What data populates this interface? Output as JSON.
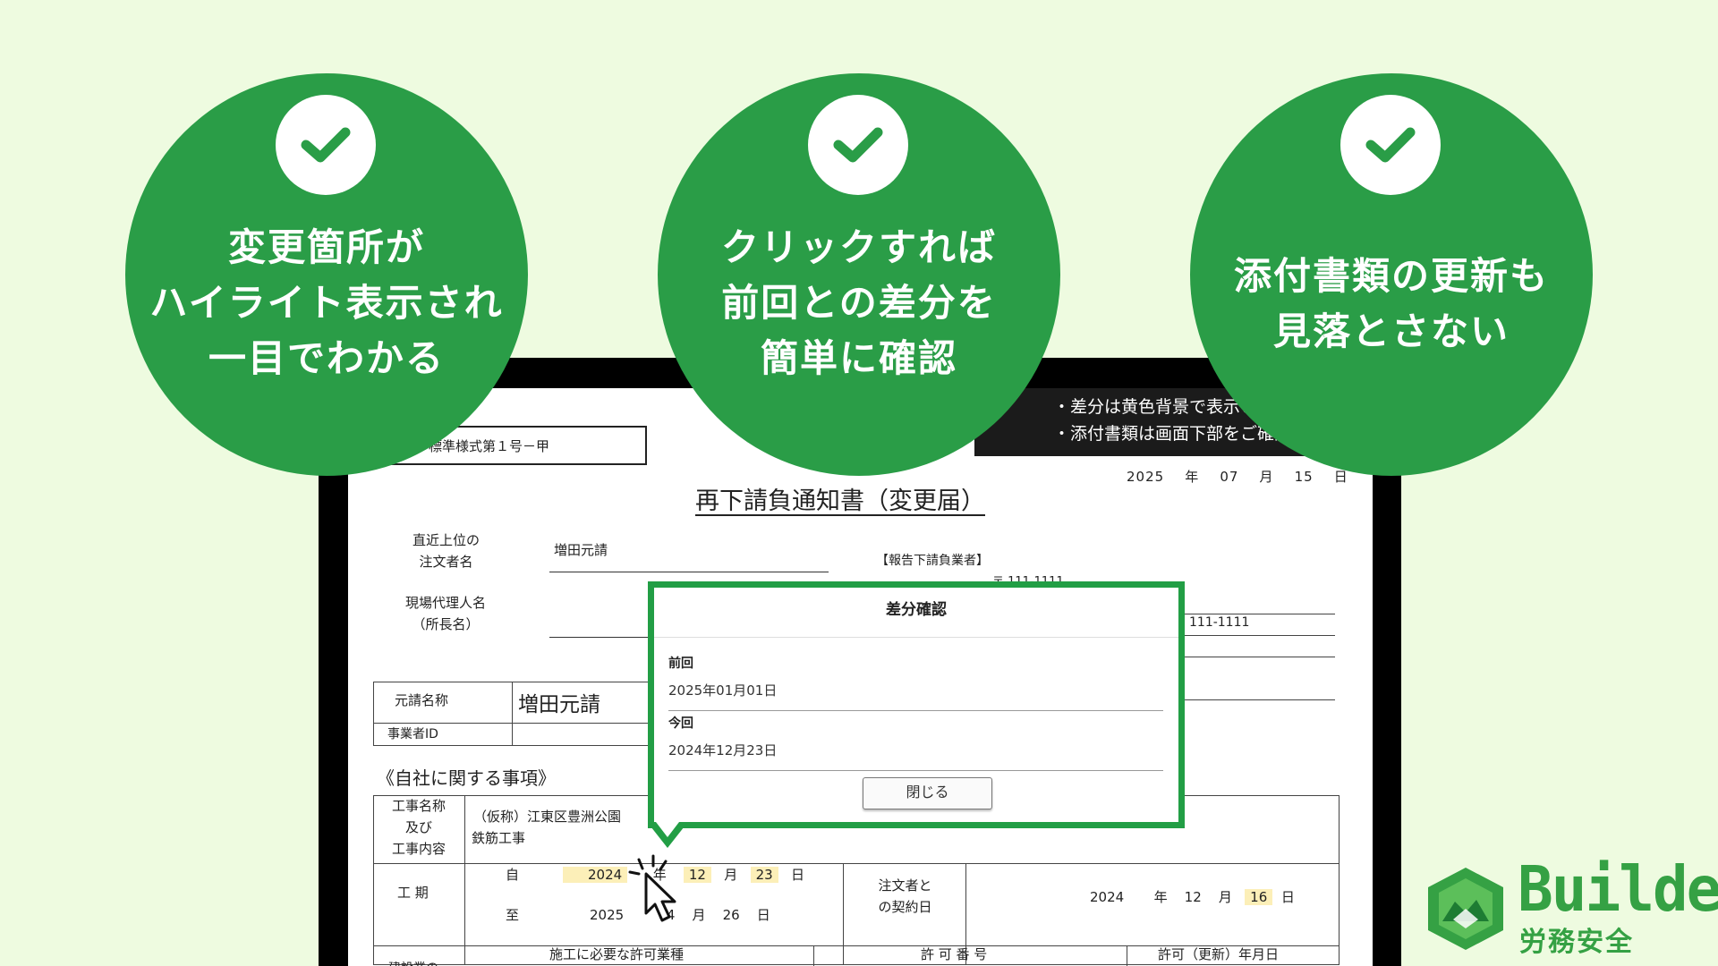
{
  "features": [
    {
      "lines": [
        "変更箇所が",
        "ハイライト表示され",
        "一目でわかる"
      ]
    },
    {
      "lines": [
        "クリックすれば",
        "前回との差分を",
        "簡単に確認"
      ]
    },
    {
      "lines": [
        "添付書類の更新も",
        "見落とさない"
      ]
    }
  ],
  "document": {
    "form_number": "標準様式第１号－甲",
    "notice_lines": [
      "・差分は黄色背景で表示され",
      "・添付書類は画面下部をご確認く"
    ],
    "date": {
      "year": "2025",
      "year_unit": "年",
      "month": "07",
      "month_unit": "月",
      "day": "15",
      "day_unit": "日"
    },
    "title": "再下請負通知書（変更届）",
    "orderer_label": [
      "直近上位の",
      "注文者名"
    ],
    "orderer_value": "増田元請",
    "site_agent_label": [
      "現場代理人名",
      "（所長名）"
    ],
    "reporter_label": "【報告下請負業者】",
    "reporter_partial": "〒 111-1111",
    "phone_partial": "111-1111",
    "prime_name_label": "元請名称",
    "prime_name_value": "増田元請",
    "business_id_label": "事業者ID",
    "section_heading": "《自社に関する事項》",
    "work_name_label": [
      "工事名称",
      "及び",
      "工事内容"
    ],
    "work_name_value": [
      "（仮称）江東区豊洲公園",
      "鉄筋工事"
    ],
    "period_label": "工 期",
    "period_from_label": "自",
    "period_to_label": "至",
    "period_from": {
      "year": "2024",
      "month": "12",
      "day": "23"
    },
    "period_to": {
      "year": "2025",
      "month": "04",
      "day": "26"
    },
    "unit_year": "年",
    "unit_month": "月",
    "unit_day": "日",
    "contract_date_label": [
      "注文者と",
      "の契約日"
    ],
    "contract_date": {
      "year": "2024",
      "month": "12",
      "day": "16"
    },
    "bottom_headers": [
      "建設業の",
      "施工に必要な許可業種",
      "許 可 番 号",
      "許可（更新）年月日"
    ]
  },
  "popup": {
    "title": "差分確認",
    "previous_label": "前回",
    "previous_value": "2025年01月01日",
    "current_label": "今回",
    "current_value": "2024年12月23日",
    "close_label": "閉じる"
  },
  "logo": {
    "word": "Buildee",
    "sub": "労務安全"
  },
  "colors": {
    "background": "#eefbe0",
    "brand_green": "#2a9d47",
    "highlight": "#fcefb8",
    "popup_border": "#229e45"
  },
  "icons": [
    "check-icon",
    "cursor-icon",
    "click-burst-icon",
    "buildee-logo-icon"
  ]
}
